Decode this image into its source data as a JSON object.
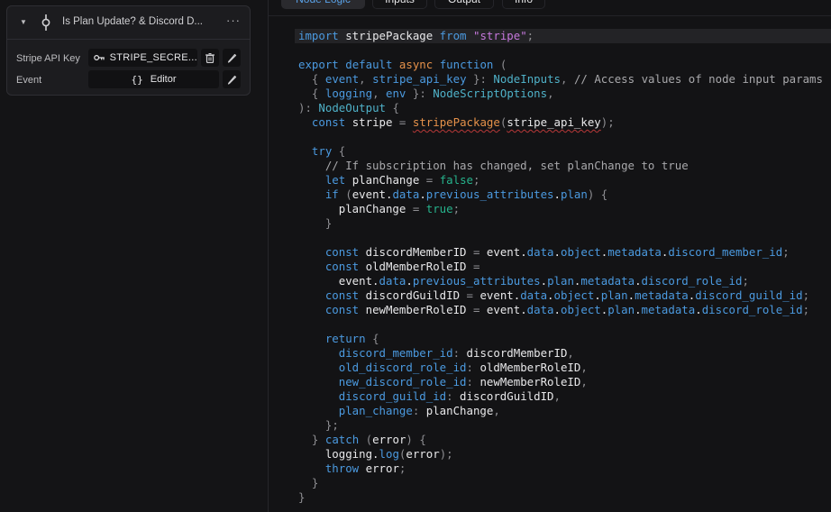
{
  "node": {
    "title": "Is Plan Update? & Discord D...",
    "fields": [
      {
        "label": "Stripe API Key",
        "value": "STRIPE_SECRE...",
        "icon": "key-icon"
      },
      {
        "label": "Event",
        "value": "Editor",
        "icon": "braces-icon"
      }
    ]
  },
  "tabs": [
    {
      "label": "Node Logic",
      "active": true
    },
    {
      "label": "Inputs",
      "active": false
    },
    {
      "label": "Output",
      "active": false
    },
    {
      "label": "Info",
      "active": false
    }
  ],
  "code": {
    "language": "typescript",
    "lines": [
      "import stripePackage from \"stripe\";",
      "",
      "export default async function (",
      "  { event, stripe_api_key }: NodeInputs, // Access values of node input params",
      "  { logging, env }: NodeScriptOptions,",
      "): NodeOutput {",
      "  const stripe = stripePackage(stripe_api_key);",
      "",
      "  try {",
      "    // If subscription has changed, set planChange to true",
      "    let planChange = false;",
      "    if (event.data.previous_attributes.plan) {",
      "      planChange = true;",
      "    }",
      "",
      "    const discordMemberID = event.data.object.metadata.discord_member_id;",
      "    const oldMemberRoleID =",
      "      event.data.previous_attributes.plan.metadata.discord_role_id;",
      "    const discordGuildID = event.data.object.plan.metadata.discord_guild_id;",
      "    const newMemberRoleID = event.data.object.plan.metadata.discord_role_id;",
      "",
      "    return {",
      "      discord_member_id: discordMemberID,",
      "      old_discord_role_id: oldMemberRoleID,",
      "      new_discord_role_id: newMemberRoleID,",
      "      discord_guild_id: discordGuildID,",
      "      plan_change: planChange,",
      "    };",
      "  } catch (error) {",
      "    logging.log(error);",
      "    throw error;",
      "  }",
      "}"
    ]
  },
  "colors": {
    "keyword": "#4b9ae0",
    "async": "#e5914a",
    "string": "#c678dd",
    "type": "#4fb1c8",
    "boolean": "#26b38c",
    "comment": "#a8a8ab",
    "active_tab": "#5aa2e8"
  }
}
